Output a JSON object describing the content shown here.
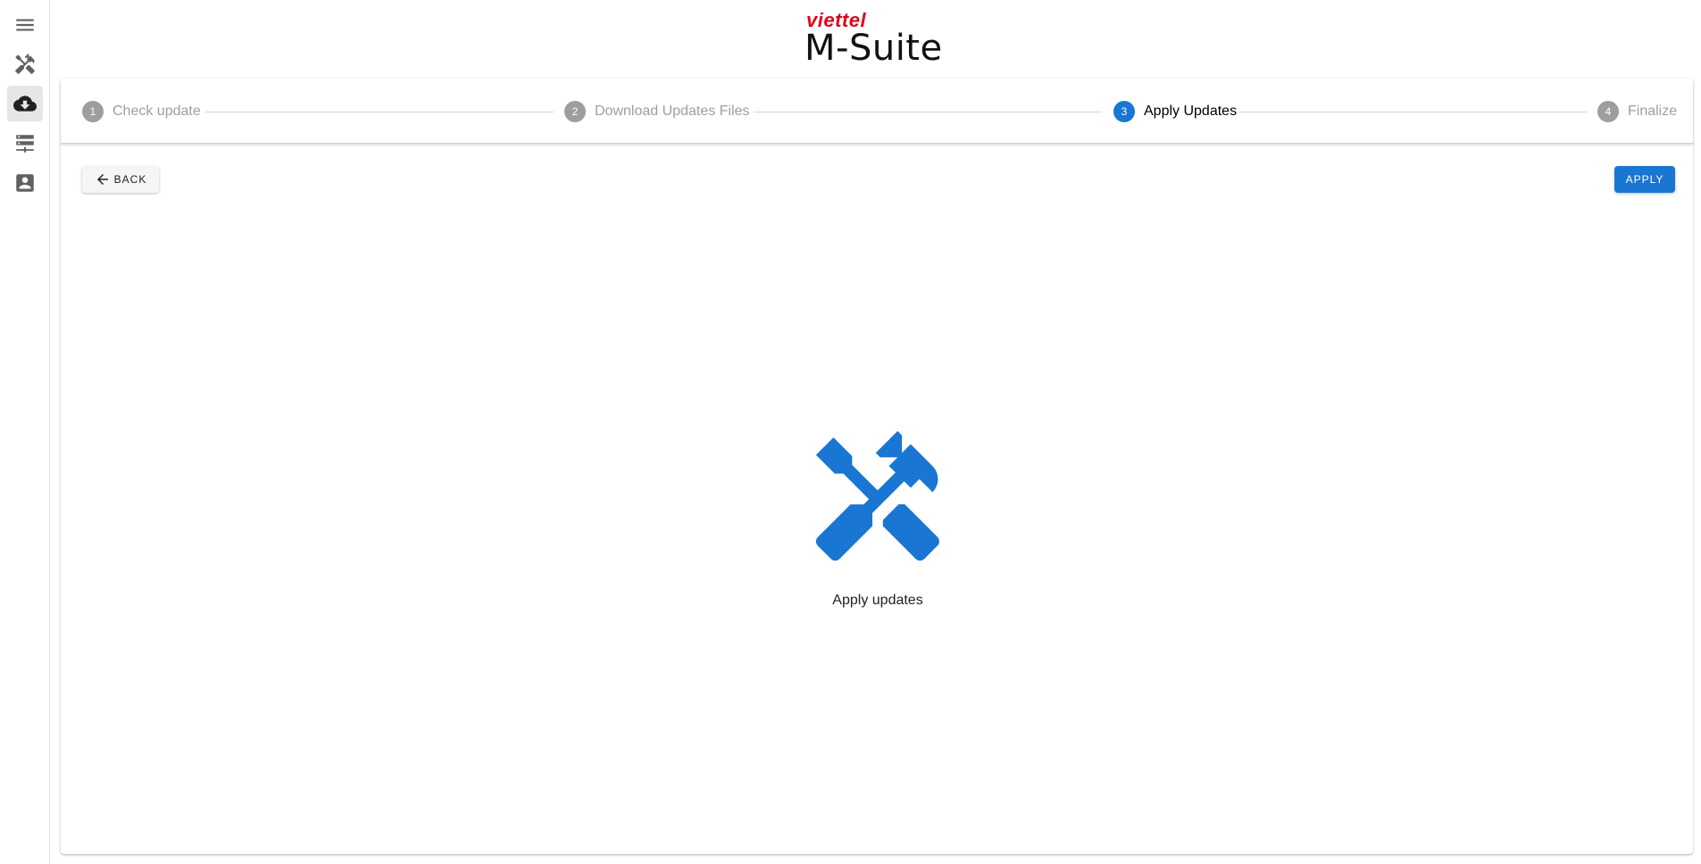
{
  "brand": {
    "top": "viettel",
    "main": "M-Suite"
  },
  "sidebar": {
    "items": [
      {
        "icon": "menu-icon"
      },
      {
        "icon": "tools-icon"
      },
      {
        "icon": "cloud-download-icon",
        "active": true
      },
      {
        "icon": "server-icon"
      },
      {
        "icon": "account-box-icon"
      }
    ]
  },
  "stepper": {
    "steps": [
      {
        "number": "1",
        "label": "Check update",
        "state": "inactive"
      },
      {
        "number": "2",
        "label": "Download Updates Files",
        "state": "inactive"
      },
      {
        "number": "3",
        "label": "Apply Updates",
        "state": "active"
      },
      {
        "number": "4",
        "label": "Finalize",
        "state": "inactive"
      }
    ]
  },
  "actions": {
    "back_label": "BACK",
    "apply_label": "APPLY"
  },
  "content": {
    "icon": "tools-icon",
    "label": "Apply updates"
  },
  "colors": {
    "primary": "#1976d2",
    "inactive_step": "#9e9e9e",
    "brand_red": "#e3001b"
  }
}
